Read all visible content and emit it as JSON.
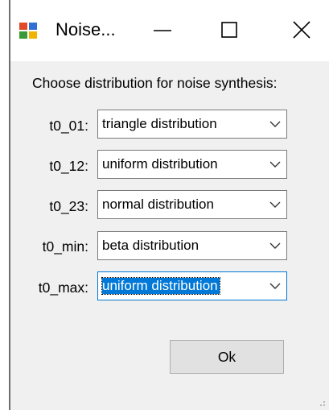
{
  "window": {
    "title": "Noise...",
    "minimize_icon": "minimize-icon",
    "maximize_icon": "maximize-icon",
    "close_icon": "close-icon"
  },
  "dialog": {
    "prompt": "Choose distribution for noise synthesis:",
    "rows": [
      {
        "label": "t0_01:",
        "value": "triangle distribution"
      },
      {
        "label": "t0_12:",
        "value": "uniform distribution"
      },
      {
        "label": "t0_23:",
        "value": "normal distribution"
      },
      {
        "label": "t0_min:",
        "value": "beta distribution"
      },
      {
        "label": "t0_max:",
        "value": "uniform distribution"
      }
    ],
    "ok_label": "Ok"
  },
  "colors": {
    "selection": "#0078d7",
    "content_bg": "#f0f0f0",
    "button_bg": "#e1e1e1"
  }
}
